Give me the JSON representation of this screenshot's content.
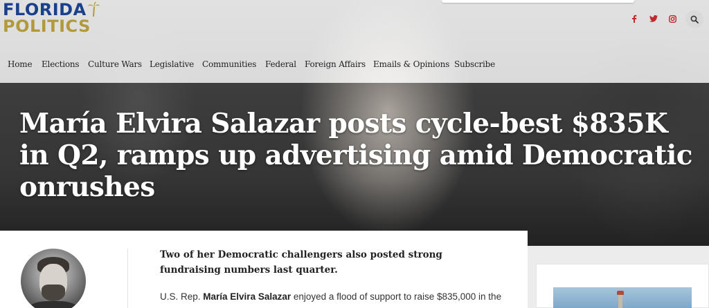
{
  "site": {
    "logo_line1": "FLORIDA",
    "logo_line2": "POLITICS"
  },
  "social": {
    "facebook_icon": "facebook-icon",
    "twitter_icon": "twitter-icon",
    "instagram_icon": "instagram-icon",
    "search_icon": "search-icon",
    "brand_red": "#c1272d"
  },
  "nav": {
    "items": [
      {
        "label": "Home"
      },
      {
        "label": "Elections"
      },
      {
        "label": "Culture Wars"
      },
      {
        "label": "Legislative"
      },
      {
        "label": "Communities"
      },
      {
        "label": "Federal"
      },
      {
        "label": "Foreign Affairs"
      },
      {
        "label": "Emails & Opinions"
      },
      {
        "label": "Subscribe"
      }
    ]
  },
  "article": {
    "headline": "María Elvira Salazar posts cycle-best $835K in Q2, ramps up advertising amid Democratic onrushes",
    "subhead": "Two of her Democratic challengers also posted strong fundraising numbers last quarter.",
    "body_prefix": "U.S. Rep. ",
    "body_name": "María Elvira Salazar",
    "body_rest": " enjoyed a flood of support to raise $835,000 in the"
  }
}
